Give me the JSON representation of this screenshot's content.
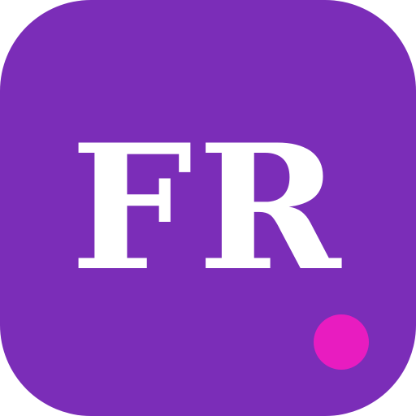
{
  "app_icon": {
    "monogram": "FR",
    "background_color": "#7b2db8",
    "text_color": "#ffffff",
    "badge": {
      "icon": "notification-dot-icon",
      "color": "#e81cc0"
    }
  }
}
